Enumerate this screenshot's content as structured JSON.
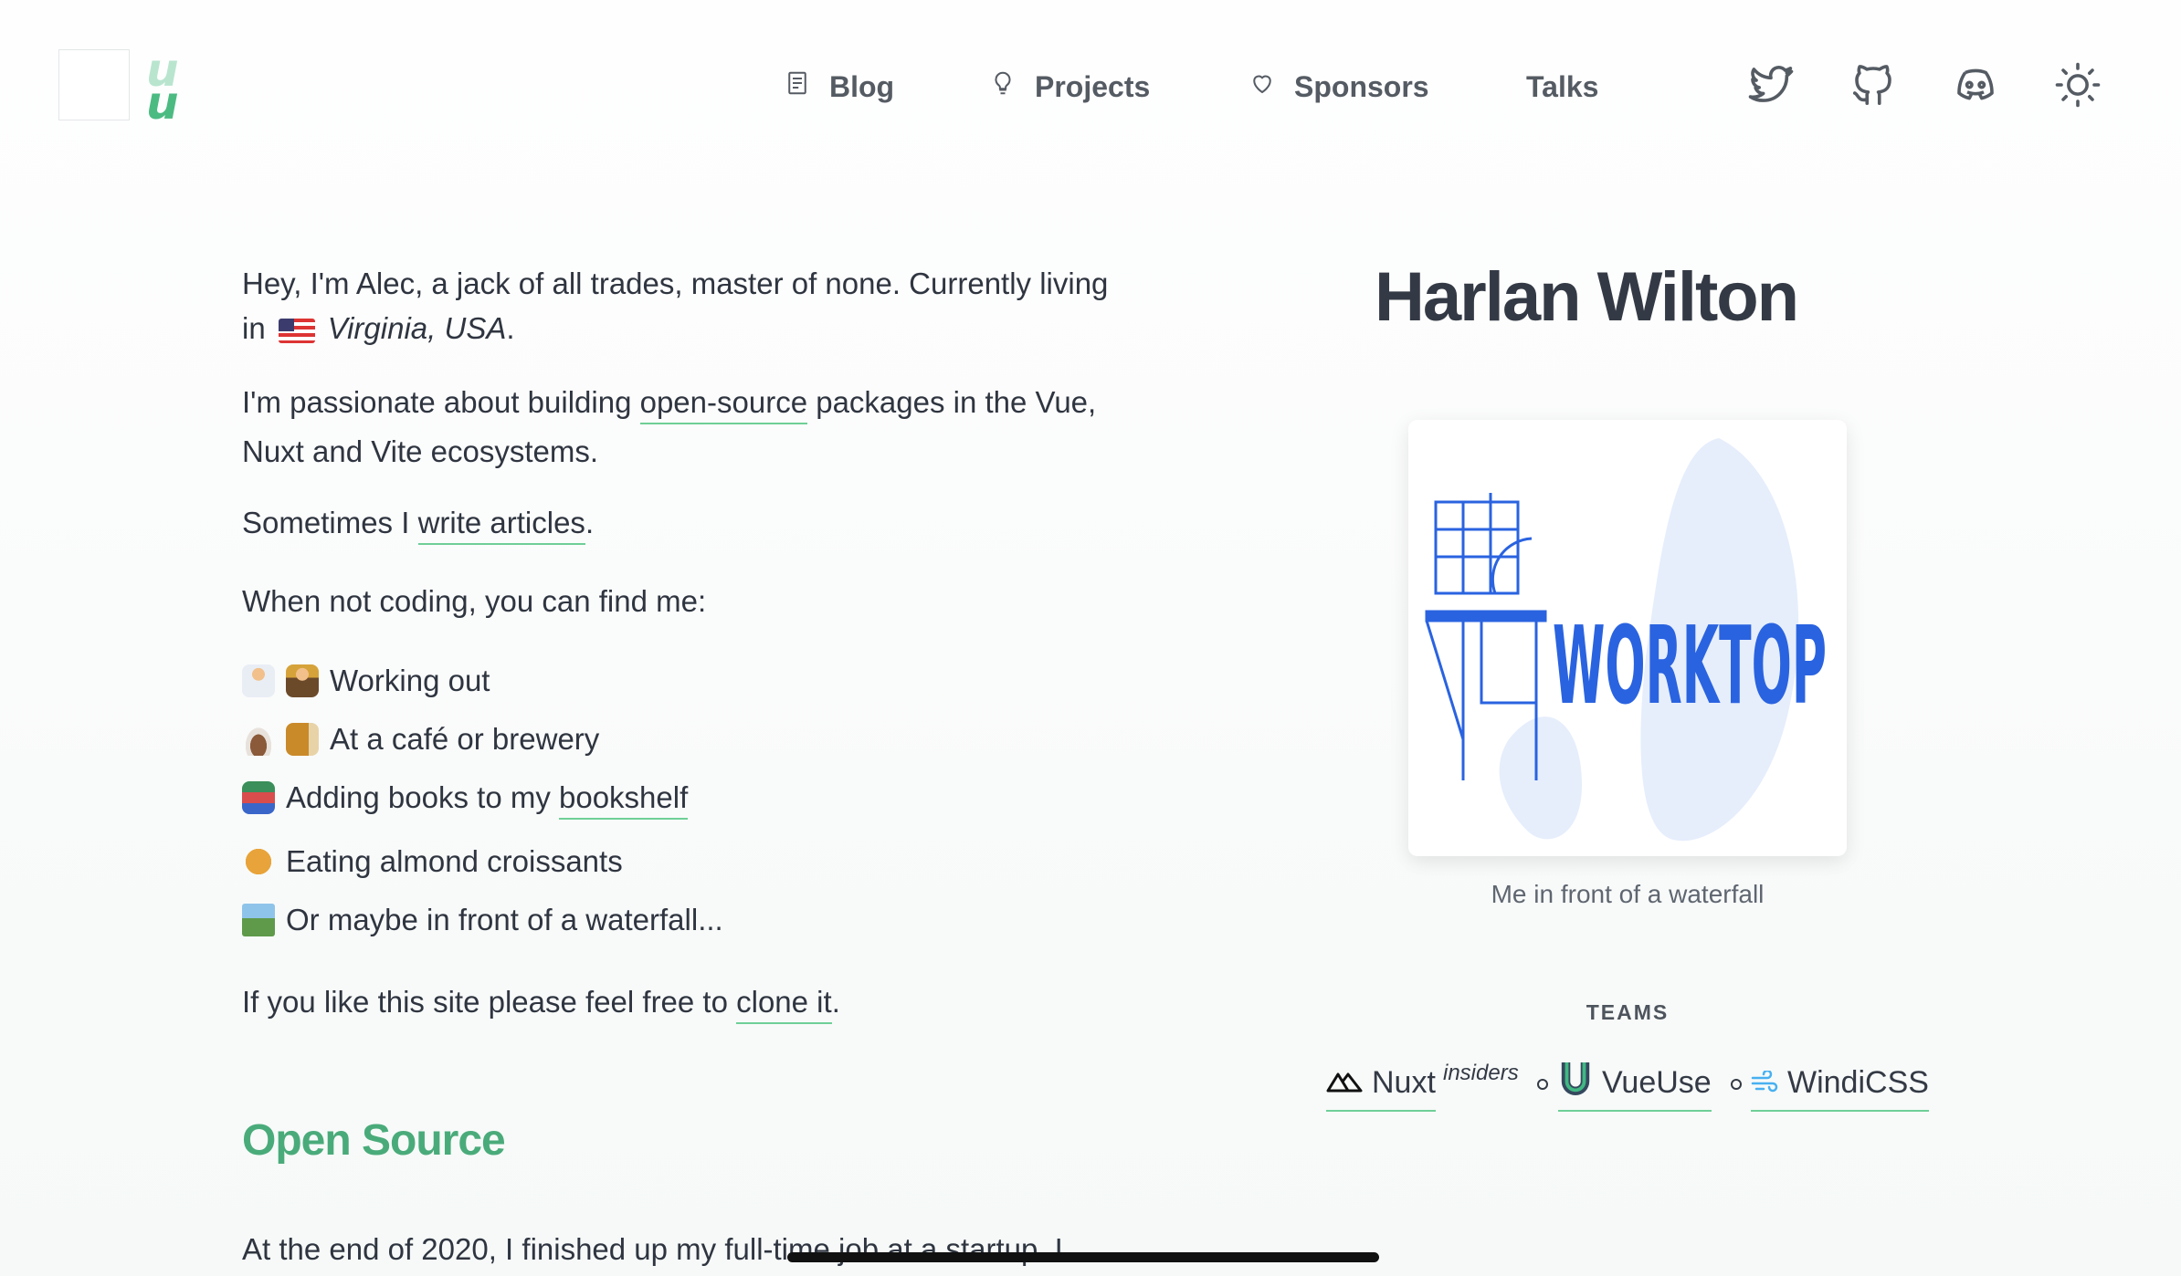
{
  "header": {
    "logo_letters": [
      "u",
      "u"
    ],
    "nav": [
      {
        "label": "Blog",
        "icon": "article-icon"
      },
      {
        "label": "Projects",
        "icon": "lightbulb-icon"
      },
      {
        "label": "Sponsors",
        "icon": "heart-icon"
      },
      {
        "label": "Talks",
        "icon": ""
      }
    ],
    "social": [
      "twitter-icon",
      "github-icon",
      "discord-icon",
      "sun-icon"
    ]
  },
  "intro": {
    "line1": "Hey, I'm Alec, a jack of all trades, master of none. Currently living",
    "line1_in": "in",
    "location": "Virginia, USA",
    "location_end": ".",
    "p2_before": "I'm passionate about building ",
    "p2_link": "open-source",
    "p2_after": " packages in the Vue,",
    "p2_line2": "Nuxt and Vite ecosystems.",
    "p3_before": "Sometimes I ",
    "p3_link": "write articles",
    "p3_after": ".",
    "p4": "When not coding, you can find me:"
  },
  "activities": [
    {
      "emojis": [
        "running-emoji",
        "weightlifting-emoji"
      ],
      "text": "Working out",
      "link": ""
    },
    {
      "emojis": [
        "coffee-emoji",
        "beer-emoji"
      ],
      "text": "At a café or brewery",
      "link": ""
    },
    {
      "emojis": [
        "books-emoji"
      ],
      "text": "Adding books to my ",
      "link": "bookshelf"
    },
    {
      "emojis": [
        "croissant-emoji"
      ],
      "text": "Eating almond croissants",
      "link": ""
    },
    {
      "emojis": [
        "landscape-emoji"
      ],
      "text": "Or maybe in front of a waterfall...",
      "link": ""
    }
  ],
  "clone": {
    "before": "If you like this site please feel free to ",
    "link": "clone it",
    "after": "."
  },
  "open_source": {
    "title": "Open Source",
    "text": "At the end of 2020, I finished up my full-time job at a startup. I"
  },
  "profile": {
    "name": "Harlan Wilton",
    "image_text": "WORKTOP",
    "caption": "Me in front of a waterfall",
    "teams_label": "TEAMS",
    "teams": [
      {
        "name": "Nuxt",
        "icon": "nuxt-icon",
        "sup": "insiders"
      },
      {
        "name": "VueUse",
        "icon": "vueuse-icon"
      },
      {
        "name": "WindiCSS",
        "icon": "windicss-icon"
      }
    ]
  },
  "colors": {
    "accent": "#4aab7a",
    "underline": "#6fcf97",
    "text": "#2f3540",
    "worktop_blue": "#2a63e0"
  }
}
